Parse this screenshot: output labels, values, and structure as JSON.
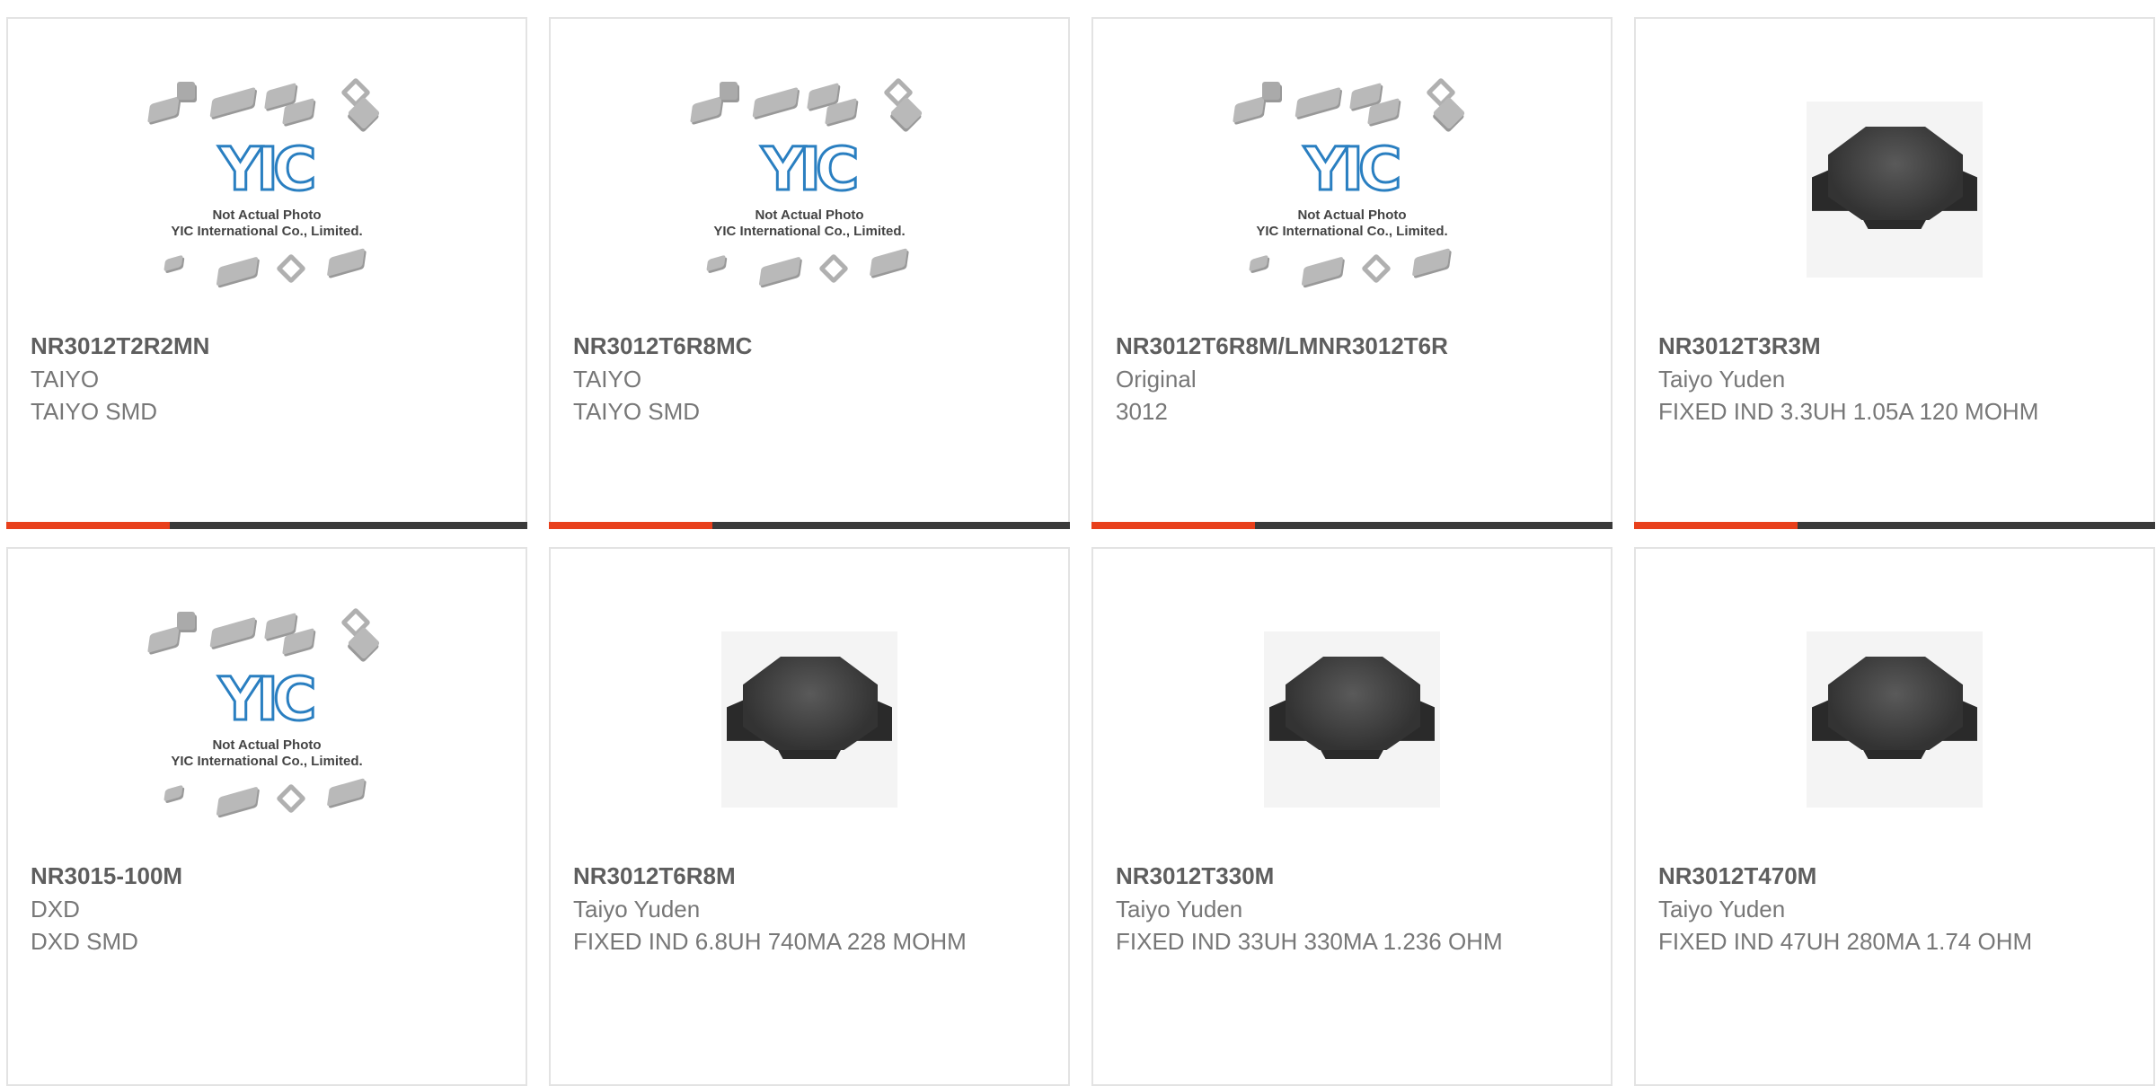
{
  "colors": {
    "accent": "#e8401c",
    "bar": "#3a3a3a",
    "border": "#e3e3e3",
    "logo_blue": "#2a7fc1"
  },
  "placeholder": {
    "logo_text": "YIC",
    "caption_line1": "Not Actual Photo",
    "caption_line2": "YIC International Co., Limited."
  },
  "products": [
    {
      "part": "NR3012T2R2MN",
      "maker": "TAIYO",
      "desc": "TAIYO SMD",
      "image": "placeholder"
    },
    {
      "part": "NR3012T6R8MC",
      "maker": "TAIYO",
      "desc": "TAIYO SMD",
      "image": "placeholder"
    },
    {
      "part": "NR3012T6R8M/LMNR3012T6R",
      "maker": "Original",
      "desc": "3012",
      "image": "placeholder"
    },
    {
      "part": "NR3012T3R3M",
      "maker": "Taiyo Yuden",
      "desc": "FIXED IND 3.3UH 1.05A 120 MOHM",
      "image": "inductor-photo"
    },
    {
      "part": "NR3015-100M",
      "maker": "DXD",
      "desc": "DXD SMD",
      "image": "placeholder"
    },
    {
      "part": "NR3012T6R8M",
      "maker": "Taiyo Yuden",
      "desc": "FIXED IND 6.8UH 740MA 228 MOHM",
      "image": "inductor-photo"
    },
    {
      "part": "NR3012T330M",
      "maker": "Taiyo Yuden",
      "desc": "FIXED IND 33UH 330MA 1.236 OHM",
      "image": "inductor-photo"
    },
    {
      "part": "NR3012T470M",
      "maker": "Taiyo Yuden",
      "desc": "FIXED IND 47UH 280MA 1.74 OHM",
      "image": "inductor-photo"
    }
  ]
}
